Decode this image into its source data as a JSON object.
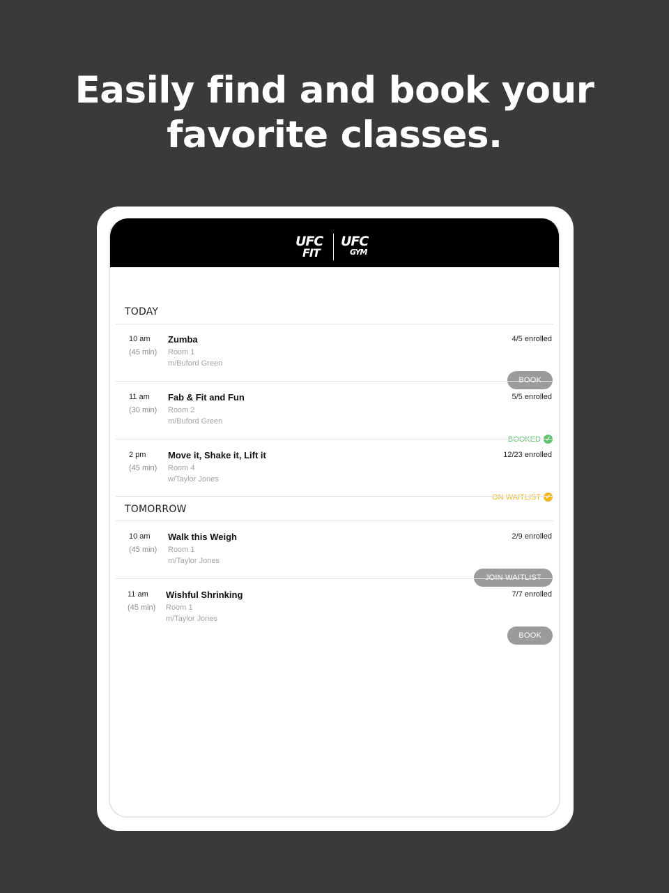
{
  "headline": {
    "line1": "Easily find and book your",
    "line2": "favorite classes."
  },
  "logo": {
    "left_top": "UFC",
    "left_bottom": "FIT",
    "right_top": "UFC",
    "right_bottom": "GYM"
  },
  "colors": {
    "booked": "#5fc46a",
    "waitlist": "#f5b81c",
    "button": "#9b9b9b"
  },
  "sections": [
    {
      "title": "TODAY",
      "classes": [
        {
          "time": "10 am",
          "duration": "(45 min)",
          "name": "Zumba",
          "room": "Room 1",
          "instructor": "m/Buford Green",
          "enrolled": "4/5 enrolled",
          "action": "BOOK"
        },
        {
          "time": "11 am",
          "duration": "(30 min)",
          "name": "Fab & Fit and Fun",
          "room": "Room 2",
          "instructor": "m/Buford Green",
          "enrolled": "5/5 enrolled",
          "status": "BOOKED",
          "status_icon": "check-icon"
        },
        {
          "time": "2 pm",
          "duration": "(45 min)",
          "name": "Move it, Shake it, Lift it",
          "room": "Room 4",
          "instructor": "w/Taylor Jones",
          "enrolled": "12/23 enrolled",
          "status": "ON WAITLIST",
          "status_icon": "check-icon"
        }
      ]
    },
    {
      "title": "TOMORROW",
      "classes": [
        {
          "time": "10 am",
          "duration": "(45 min)",
          "name": "Walk this Weigh",
          "room": "Room 1",
          "instructor": "m/Taylor Jones",
          "enrolled": "2/9 enrolled",
          "action": "JOIN WAITLIST"
        },
        {
          "time": "11 am",
          "duration": "(45 min)",
          "name": "Wishful Shrinking",
          "room": "Room 1",
          "instructor": "m/Taylor Jones",
          "enrolled": "7/7 enrolled",
          "action": "BOOK"
        }
      ]
    }
  ]
}
